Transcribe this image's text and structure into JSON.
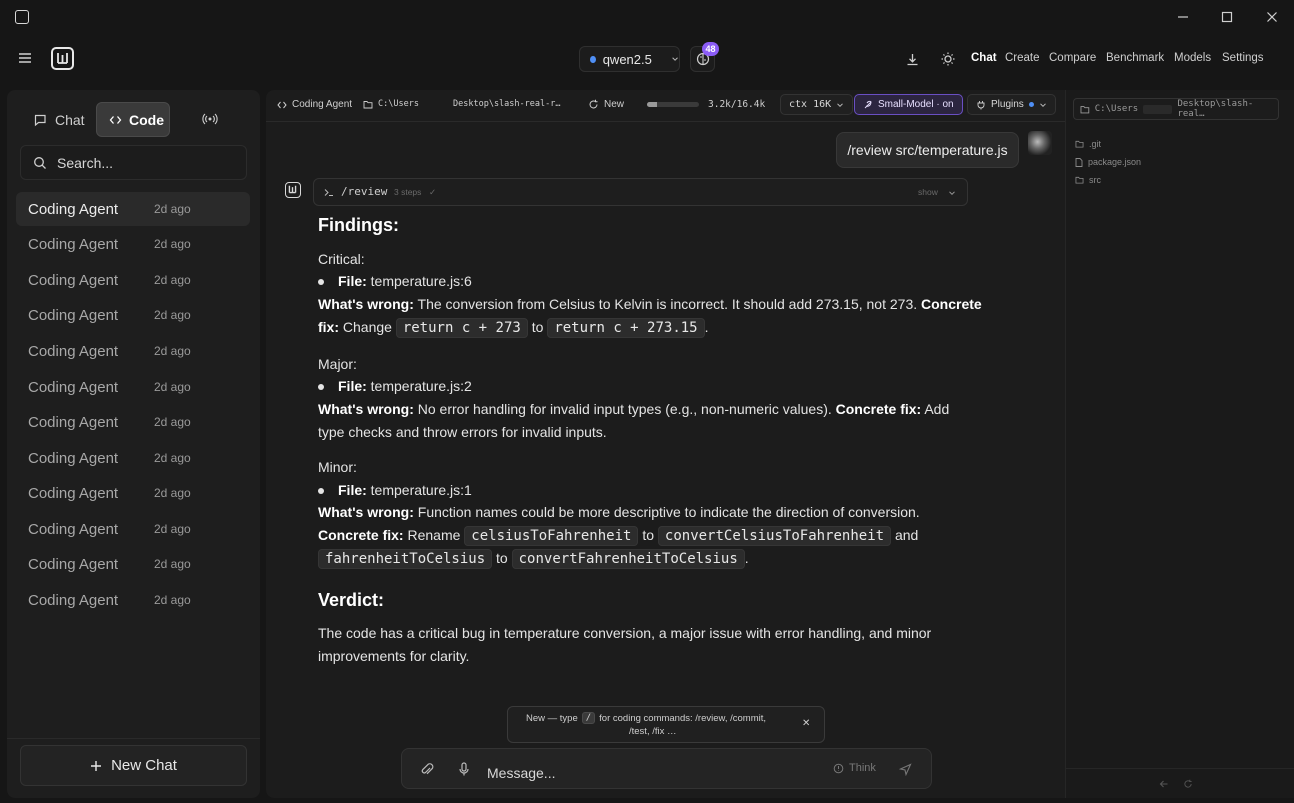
{
  "window": {
    "minimize_label": "—",
    "maximize_label": "☐",
    "close_label": "✕"
  },
  "header": {
    "model": "qwen2.5",
    "brain_badge": "48",
    "nav": [
      "Chat",
      "Create",
      "Compare",
      "Benchmark",
      "Models",
      "Settings"
    ],
    "active_nav": "Chat"
  },
  "sidebar": {
    "tabs": {
      "chat": "Chat",
      "code": "Code"
    },
    "search_placeholder": "Search...",
    "conversations": [
      {
        "title": "Coding Agent",
        "time": "2d ago"
      },
      {
        "title": "Coding Agent",
        "time": "2d ago"
      },
      {
        "title": "Coding Agent",
        "time": "2d ago"
      },
      {
        "title": "Coding Agent",
        "time": "2d ago"
      },
      {
        "title": "Coding Agent",
        "time": "2d ago"
      },
      {
        "title": "Coding Agent",
        "time": "2d ago"
      },
      {
        "title": "Coding Agent",
        "time": "2d ago"
      },
      {
        "title": "Coding Agent",
        "time": "2d ago"
      },
      {
        "title": "Coding Agent",
        "time": "2d ago"
      },
      {
        "title": "Coding Agent",
        "time": "2d ago"
      },
      {
        "title": "Coding Agent",
        "time": "2d ago"
      },
      {
        "title": "Coding Agent",
        "time": "2d ago"
      }
    ],
    "new_chat": "New Chat"
  },
  "toolbar": {
    "agent": "Coding Agent",
    "path_start": "C:\\Users",
    "path_end": "Desktop\\slash-real-r…",
    "new_label": "New",
    "tokens": "3.2k/16.4k",
    "token_fraction": 0.2,
    "ctx": "ctx 16K",
    "small_model": "Small-Model · on",
    "plugins": "Plugins"
  },
  "right_panel": {
    "path_start": "C:\\Users",
    "path_end": "Desktop\\slash-real…",
    "files": [
      ".git",
      "package.json",
      "src"
    ]
  },
  "chat": {
    "user_message": "/review src/temperature.js",
    "steps_command": "/review",
    "steps_count": "3 steps",
    "steps_check": "✓",
    "steps_toggle": "show",
    "findings_heading": "Findings:",
    "critical_label": "Critical:",
    "critical_file_label": "File:",
    "critical_file": "temperature.js:6",
    "critical_wrong_label": "What's wrong:",
    "critical_wrong": "The conversion from Celsius to Kelvin is incorrect. It should add 273.15, not 273.",
    "critical_fix_label_1": "Concrete",
    "critical_fix_label_2": "fix:",
    "critical_fix_prefix": "Change",
    "critical_code_1": "return c + 273",
    "critical_to": "to",
    "critical_code_2": "return c + 273.15",
    "critical_period": ".",
    "major_label": "Major:",
    "major_file_label": "File:",
    "major_file": "temperature.js:2",
    "major_wrong_label": "What's wrong:",
    "major_wrong": "No error handling for invalid input types (e.g., non-numeric values).",
    "major_fix_label": "Concrete fix:",
    "major_fix_1": "Add",
    "major_fix_2": "type checks and throw errors for invalid inputs.",
    "minor_label": "Minor:",
    "minor_file_label": "File:",
    "minor_file": "temperature.js:1",
    "minor_wrong_label": "What's wrong:",
    "minor_wrong": "Function names could be more descriptive to indicate the direction of conversion.",
    "minor_fix_label": "Concrete fix:",
    "minor_fix_prefix": "Rename",
    "minor_code_1": "celsiusToFahrenheit",
    "minor_to_1": "to",
    "minor_code_2": "convertCelsiusToFahrenheit",
    "minor_and": "and",
    "minor_code_3": "fahrenheitToCelsius",
    "minor_to_2": "to",
    "minor_code_4": "convertFahrenheitToCelsius",
    "minor_period": ".",
    "verdict_heading": "Verdict:",
    "verdict_1": "The code has a critical bug in temperature conversion, a major issue with error handling, and minor",
    "verdict_2": "improvements for clarity."
  },
  "toast": {
    "prefix": "New — type",
    "key": "/",
    "suffix": "for coding commands: /review, /commit,",
    "line2": "/test, /fix …",
    "close": "✕"
  },
  "composer": {
    "placeholder": "Message...",
    "think_label": "Think"
  },
  "colors": {
    "accent": "#8b5cf6",
    "model_dot": "#4f8ff5",
    "background": "#161616"
  }
}
